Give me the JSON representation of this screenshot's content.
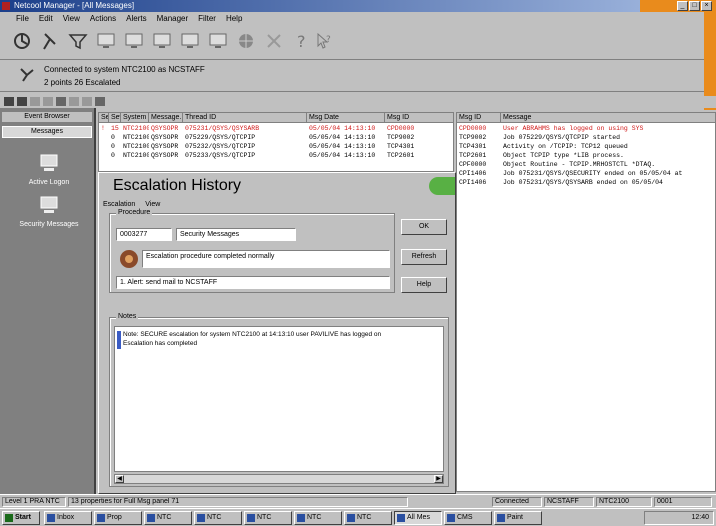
{
  "window": {
    "title": "Netcool Manager - [All Messages]",
    "min": "_",
    "max": "□",
    "close": "×"
  },
  "menu": [
    "File",
    "Edit",
    "View",
    "Actions",
    "Alerts",
    "Manager",
    "Filter",
    "Help"
  ],
  "connection": {
    "line1": "Connected to system NTC2100 as NCSTAFF",
    "line2": "2 points  26 Escalated"
  },
  "sidebar": {
    "header": "Event Browser",
    "subheader": "Messages",
    "items": [
      {
        "label": "Active Logon"
      },
      {
        "label": "Security Messages"
      }
    ]
  },
  "table": {
    "columns": [
      "Sev",
      "Sev",
      "System",
      "Message...",
      "Thread ID",
      "Msg Date",
      "Msg ID",
      "Message"
    ],
    "rows": [
      {
        "c1": "!",
        "c2": "15",
        "sys": "NTC2100",
        "msgq": "QSYSOPR",
        "thread": "075231/QSYS/QSYSARB",
        "date": "05/05/04 14:13:10",
        "id": "CPD0000",
        "msg": "User ABRAHMS has logged on using SYS",
        "color": "#d01818"
      },
      {
        "c1": "",
        "c2": "0",
        "sys": "NTC2100",
        "msgq": "QSYSOPR",
        "thread": "075229/QSYS/QTCPIP",
        "date": "05/05/04 14:13:10",
        "id": "TCP9002",
        "msg": "Job 075229/QSYS/QTCPIP started",
        "color": "#000000"
      },
      {
        "c1": "",
        "c2": "0",
        "sys": "NTC2100",
        "msgq": "QSYSOPR",
        "thread": "075232/QSYS/QTCPIP",
        "date": "05/05/04 14:13:10",
        "id": "TCP4301",
        "msg": "Activity on /TCPIP: TCP12 queued",
        "color": "#000000"
      },
      {
        "c1": "",
        "c2": "0",
        "sys": "NTC2100",
        "msgq": "QSYSOPR",
        "thread": "075233/QSYS/QTCPIP",
        "date": "05/05/04 14:13:10",
        "id": "TCP2601",
        "msg": "Object TCPIP type *LIB process.",
        "color": "#000000"
      }
    ],
    "right_rows": [
      {
        "id": "CPF0000",
        "msg": "Object Routine - TCPIP.MRHOSTCTL *DTAQ.",
        "color": "#000000"
      },
      {
        "id": "CPI1406",
        "msg": "Job 075231/QSYS/QSECURITY ended on 05/05/04 at",
        "color": "#000000"
      },
      {
        "id": "CPI1406",
        "msg": "Job 075231/QSYS/QSYSARB ended on 05/05/04",
        "color": "#000000"
      }
    ]
  },
  "dialog": {
    "title": "Escalation History",
    "menu": [
      "Escalation",
      "View"
    ],
    "procedure_legend": "Procedure",
    "proc_id": "0003277",
    "proc_name": "Security Messages",
    "status": "Escalation procedure completed normally",
    "action": "1. Alert: send mail to NCSTAFF",
    "notes_legend": "Notes",
    "note1": "Note: SECURE escalation for system NTC2100 at 14:13:10 user PAVILIVE has logged on",
    "note2": "Escalation has completed",
    "buttons": {
      "ok": "OK",
      "refresh": "Refresh",
      "help": "Help"
    }
  },
  "statusbar": {
    "s1": "Level 1 PRA NTC",
    "s2": "13 properties for Full Msg panel 71",
    "s3": "Connected",
    "s4": "NCSTAFF",
    "s5": "NTC2100",
    "s6": "0001"
  },
  "taskbar": {
    "start": "Start",
    "tasks": [
      "Inbox",
      "Prop",
      "NTC",
      "NTC",
      "NTC",
      "NTC",
      "NTC",
      "All Mes",
      "CMS",
      "Paint"
    ],
    "tray": "12:40"
  }
}
